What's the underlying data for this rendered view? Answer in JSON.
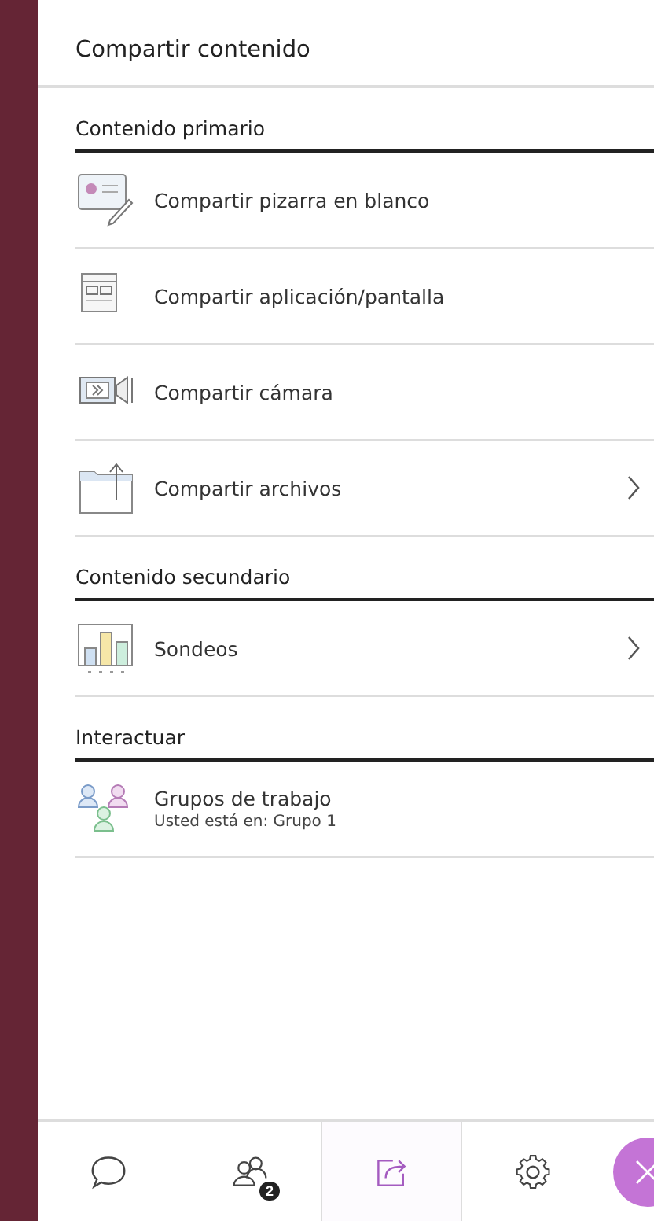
{
  "panel": {
    "title": "Compartir contenido"
  },
  "sections": [
    {
      "heading": "Contenido primario",
      "items": [
        {
          "label": "Compartir pizarra en blanco",
          "expandable": false
        },
        {
          "label": "Compartir aplicación/pantalla",
          "expandable": false
        },
        {
          "label": "Compartir cámara",
          "expandable": false
        },
        {
          "label": "Compartir archivos",
          "expandable": true
        }
      ]
    },
    {
      "heading": "Contenido secundario",
      "items": [
        {
          "label": "Sondeos",
          "expandable": true
        }
      ]
    },
    {
      "heading": "Interactuar",
      "items": [
        {
          "label": "Grupos de trabajo",
          "subtitle": "Usted está en: Grupo 1",
          "expandable": false
        }
      ]
    }
  ],
  "bottom_bar": {
    "tabs": [
      {
        "kind": "chat",
        "selected": false
      },
      {
        "kind": "attendees",
        "selected": false,
        "badge": "2"
      },
      {
        "kind": "share",
        "selected": true
      },
      {
        "kind": "settings",
        "selected": false
      }
    ],
    "close_button": {
      "shown": true
    }
  }
}
